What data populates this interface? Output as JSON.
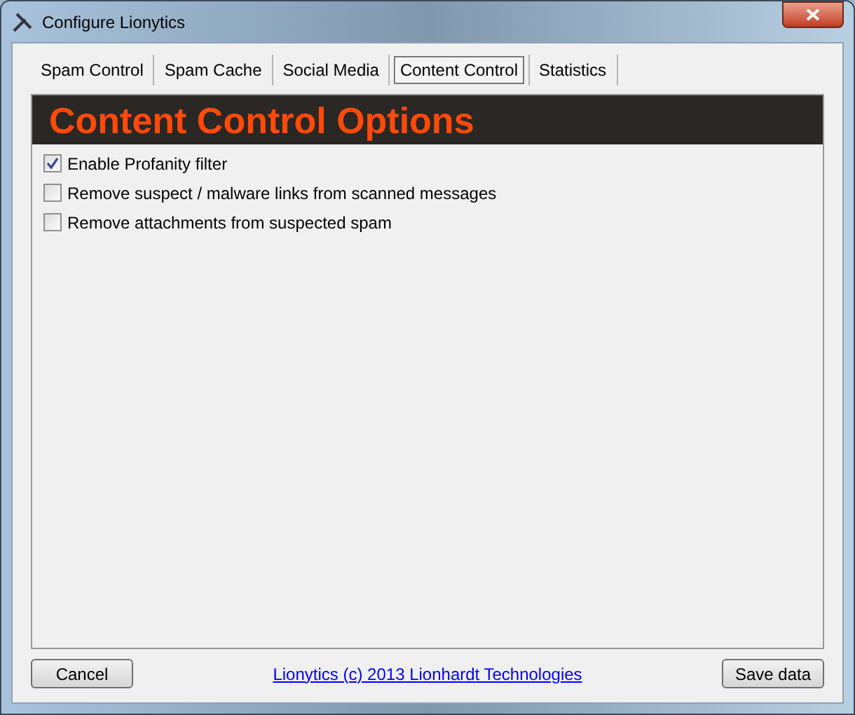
{
  "window": {
    "title": "Configure Lionytics"
  },
  "tabs": [
    {
      "label": "Spam Control",
      "selected": false
    },
    {
      "label": "Spam Cache",
      "selected": false
    },
    {
      "label": "Social Media",
      "selected": false
    },
    {
      "label": "Content Control",
      "selected": true
    },
    {
      "label": "Statistics",
      "selected": false
    }
  ],
  "panel": {
    "heading": "Content Control Options",
    "options": [
      {
        "label": "Enable Profanity filter",
        "checked": true
      },
      {
        "label": "Remove suspect / malware links from scanned messages",
        "checked": false
      },
      {
        "label": "Remove attachments from suspected spam",
        "checked": false
      }
    ]
  },
  "footer": {
    "cancel": "Cancel",
    "link": "Lionytics (c) 2013 Lionhardt Technologies",
    "save": "Save data"
  }
}
